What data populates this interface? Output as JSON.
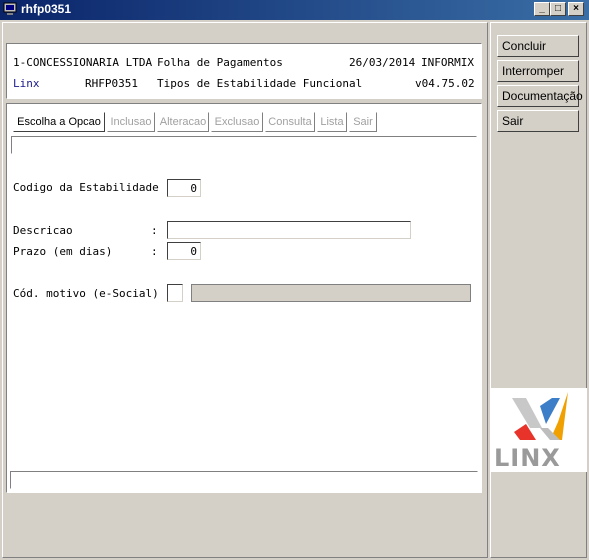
{
  "window": {
    "title": "rhfp0351",
    "min_label": "_",
    "max_label": "□",
    "close_label": "×"
  },
  "header": {
    "company": "1-CONCESSIONARIA LTDA",
    "module": "Folha de Pagamentos",
    "date": "26/03/2014",
    "db": "INFORMIX",
    "vendor": "Linx",
    "program": "RHFP0351",
    "screen_title": "Tipos de Estabilidade Funcional",
    "version": "v04.75.02"
  },
  "menu": {
    "items": [
      {
        "label": "Escolha a Opcao",
        "enabled": true
      },
      {
        "label": "Inclusao",
        "enabled": false
      },
      {
        "label": "Alteracao",
        "enabled": false
      },
      {
        "label": "Exclusao",
        "enabled": false
      },
      {
        "label": "Consulta",
        "enabled": false
      },
      {
        "label": "Lista",
        "enabled": false
      },
      {
        "label": "Sair",
        "enabled": false
      }
    ]
  },
  "form": {
    "codigo": {
      "label": "Codigo da Estabilidade :",
      "value": "0"
    },
    "descricao": {
      "label": "Descricao",
      "sep": ":",
      "value": ""
    },
    "prazo": {
      "label": "Prazo (em dias)",
      "sep": ":",
      "value": "0"
    },
    "motivo": {
      "label": "Cód. motivo (e-Social) :",
      "value": "",
      "desc": ""
    }
  },
  "sidebar": {
    "buttons": [
      "Concluir",
      "Interromper",
      "Documentação",
      "Sair"
    ]
  },
  "logo": {
    "text": "LINX"
  },
  "colors": {
    "titlebar": "#0a246a",
    "linx_blue": "#1a1a8c"
  }
}
